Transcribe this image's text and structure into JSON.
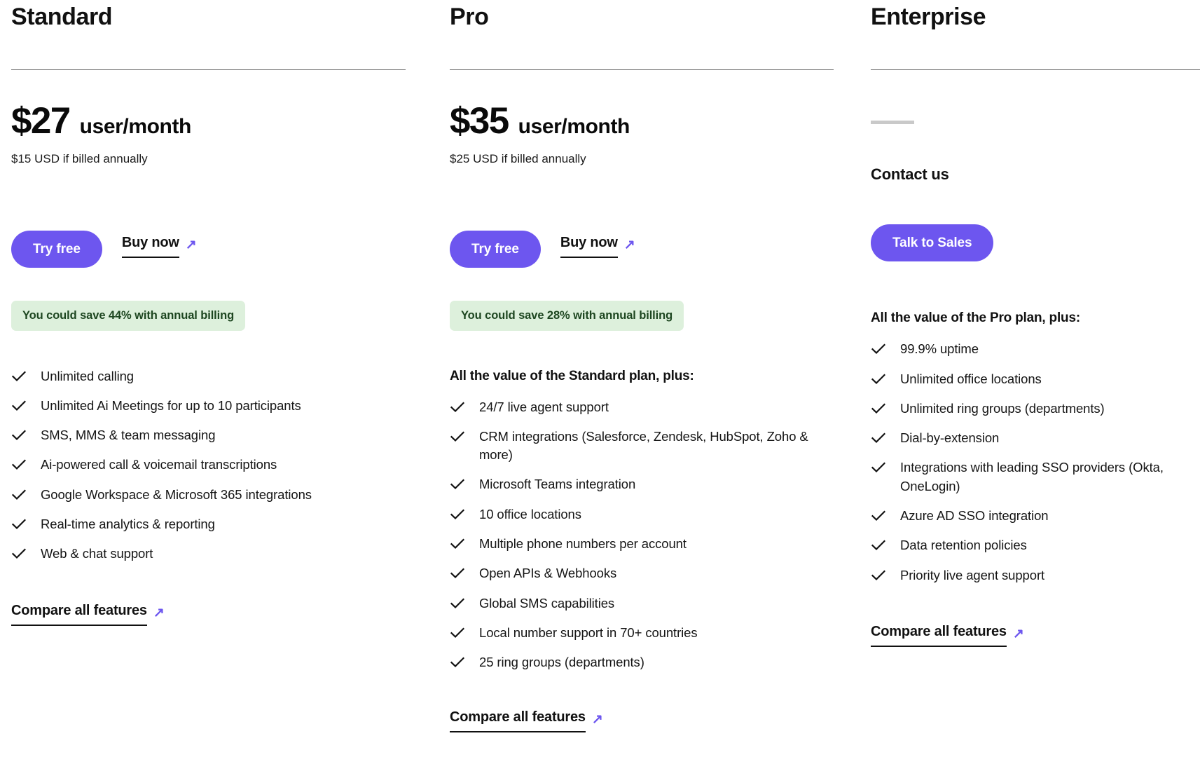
{
  "plans": [
    {
      "name": "Standard",
      "price_amount": "$27",
      "price_unit": "user/month",
      "price_annual_note": "$15 USD if billed annually",
      "primary_cta": "Try free",
      "secondary_cta": "Buy now",
      "savings_badge": "You could save 44% with annual billing",
      "features_heading": null,
      "features": [
        "Unlimited calling",
        "Unlimited Ai Meetings for up to 10 participants",
        "SMS, MMS & team messaging",
        "Ai-powered call & voicemail transcriptions",
        "Google Workspace & Microsoft 365 integrations",
        "Real-time analytics & reporting",
        "Web & chat support"
      ],
      "compare_link": "Compare all features"
    },
    {
      "name": "Pro",
      "price_amount": "$35",
      "price_unit": "user/month",
      "price_annual_note": "$25 USD if billed annually",
      "primary_cta": "Try free",
      "secondary_cta": "Buy now",
      "savings_badge": "You could save 28% with annual billing",
      "features_heading": "All the value of the Standard plan, plus:",
      "features": [
        "24/7 live agent support",
        "CRM integrations (Salesforce, Zendesk, HubSpot, Zoho & more)",
        "Microsoft Teams integration",
        "10 office locations",
        "Multiple phone numbers per account",
        "Open APIs & Webhooks",
        "Global SMS capabilities",
        "Local number support in 70+ countries",
        "25 ring groups (departments)"
      ],
      "compare_link": "Compare all features"
    },
    {
      "name": "Enterprise",
      "price_amount": null,
      "price_unit": null,
      "price_annual_note": null,
      "contact_label": "Contact us",
      "primary_cta": "Talk to Sales",
      "secondary_cta": null,
      "savings_badge": null,
      "features_heading": "All the value of the Pro plan, plus:",
      "features": [
        "99.9% uptime",
        "Unlimited office locations",
        "Unlimited ring groups (departments)",
        "Dial-by-extension",
        "Integrations with leading SSO providers (Okta, OneLogin)",
        "Azure AD SSO integration",
        "Data retention policies",
        "Priority live agent support"
      ],
      "compare_link": "Compare all features"
    }
  ],
  "icons": {
    "check": "check-icon",
    "arrow_ne": "↗"
  },
  "colors": {
    "accent_purple": "#6d56ef",
    "badge_background": "#ddf0dc",
    "badge_text": "#1d4620",
    "text_primary": "#111111",
    "rule": "#6f6f6f",
    "placeholder_dash": "#c9c9c9"
  }
}
